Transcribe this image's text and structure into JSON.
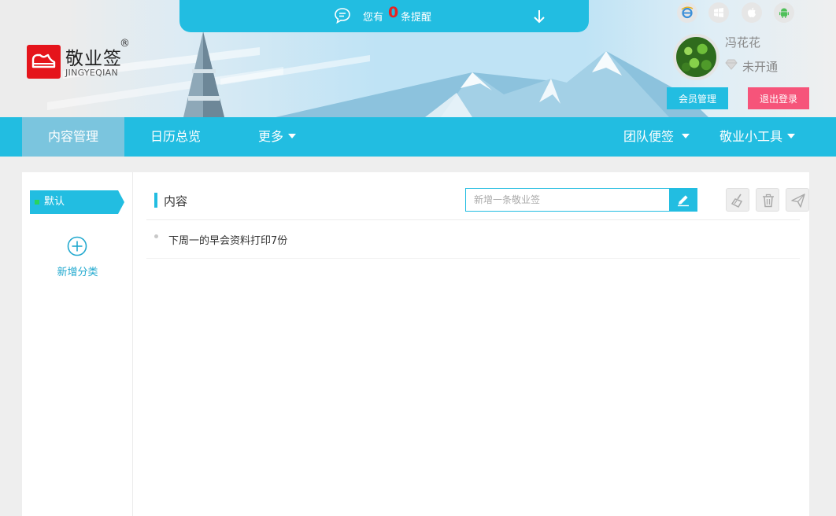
{
  "brand": {
    "name": "敬业签",
    "registered": "®",
    "subtitle": "JINGYEQIAN"
  },
  "reminder": {
    "prefix": "您有",
    "count": "0",
    "suffix": "条提醒"
  },
  "platforms": [
    "ie-icon",
    "windows-icon",
    "apple-icon",
    "android-icon"
  ],
  "user": {
    "name": "冯花花",
    "membership_status": "未开通",
    "member_button": "会员管理",
    "logout_button": "退出登录"
  },
  "nav": {
    "items": [
      {
        "label": "内容管理",
        "active": true
      },
      {
        "label": "日历总览"
      },
      {
        "label": "更多",
        "dropdown": true
      }
    ],
    "right_items": [
      {
        "label": "团队便签",
        "dropdown": true
      },
      {
        "label": "敬业小工具",
        "dropdown": true
      }
    ]
  },
  "sidebar": {
    "default_category": "默认",
    "add_category_label": "新增分类"
  },
  "content": {
    "title": "内容",
    "new_placeholder": "新增一条敬业签",
    "notes": [
      "下周一的早会资料打印7份"
    ]
  },
  "colors": {
    "primary": "#22bde1",
    "active_nav": "#7bc5de",
    "logout": "#f6547a",
    "logo": "#e5141b",
    "reminder_count": "#e82222"
  }
}
